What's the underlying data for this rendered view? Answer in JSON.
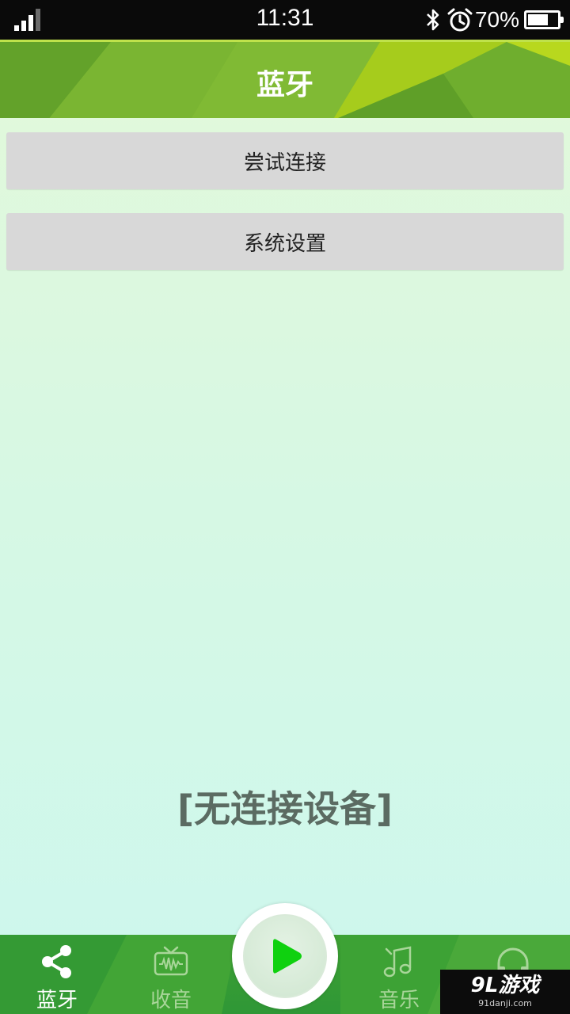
{
  "status_bar": {
    "time": "11:31",
    "battery_percent": "70%",
    "battery_level": 0.7,
    "signal_bars_active": 3,
    "icons": [
      "signal-icon",
      "bluetooth-icon",
      "alarm-icon",
      "battery-icon"
    ]
  },
  "header": {
    "title": "蓝牙"
  },
  "actions": {
    "connect_label": "尝试连接",
    "settings_label": "系统设置"
  },
  "status_message": "[无连接设备]",
  "tab_bar": {
    "tabs": [
      {
        "label": "蓝牙",
        "icon": "share-icon",
        "active": true
      },
      {
        "label": "收音",
        "icon": "radio-icon",
        "active": false
      },
      {
        "label": "音乐",
        "icon": "music-note-icon",
        "active": false
      },
      {
        "label": "",
        "icon": "headset-icon",
        "active": false
      }
    ],
    "play_icon": "play-icon"
  },
  "watermark": {
    "logo": "9L游戏",
    "url": "91danji.com"
  },
  "colors": {
    "header_green": "#74b02e",
    "tab_bar_green": "#3ea133",
    "play_green": "#0fd10f",
    "status_text": "#5b6b62"
  }
}
